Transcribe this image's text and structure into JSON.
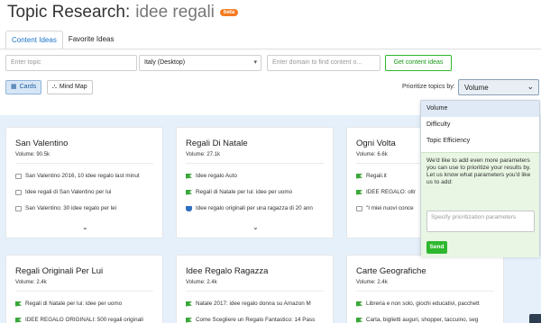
{
  "header": {
    "title_prefix": "Topic Research:",
    "keyword": "idee regali",
    "badge": "beta"
  },
  "tabs": [
    {
      "label": "Content Ideas",
      "active": true
    },
    {
      "label": "Favorite Ideas",
      "active": false
    }
  ],
  "search": {
    "topic_placeholder": "Enter topic",
    "region_value": "Italy (Desktop)",
    "domain_placeholder": "Enter domain to find content o...",
    "submit_label": "Get content ideas"
  },
  "view": {
    "cards_label": "Cards",
    "mindmap_label": "Mind Map"
  },
  "prioritize": {
    "label": "Prioritize topics by:",
    "selected": "Volume",
    "options": [
      "Volume",
      "Difficulty",
      "Topic Efficiency"
    ],
    "promo_text": "We'd like to add even more parameters you can use to prioritize your results by. Let us know what parameters you'd like us to add:",
    "input_placeholder": "Specify prioritization parameters",
    "send_label": "Send"
  },
  "cards": [
    {
      "title": "San Valentino",
      "volume": "Volume: 90.5k",
      "items": [
        {
          "icon": "doc",
          "text": "San Valentino 2016, 10 idee regalo last minut"
        },
        {
          "icon": "doc",
          "text": "Idee regali di San Valentino per lui"
        },
        {
          "icon": "doc",
          "text": "San Valentino: 30 idee regalo per lei"
        }
      ]
    },
    {
      "title": "Regali Di Natale",
      "volume": "Volume: 27.1k",
      "items": [
        {
          "icon": "flag",
          "text": "Idee regalo Auto"
        },
        {
          "icon": "flag",
          "text": "Regali di Natale per lui: idee per uomo"
        },
        {
          "icon": "shield",
          "text": "Idee regalo originali per una ragazza di 20 ann"
        }
      ]
    },
    {
      "title": "Ogni Volta",
      "volume": "Volume: 6.6k",
      "items": [
        {
          "icon": "flag",
          "text": "Regali.it"
        },
        {
          "icon": "flag",
          "text": "IDEE REGALO: oltr"
        },
        {
          "icon": "doc",
          "text": "\"I miei nuovi conce"
        }
      ]
    },
    {
      "title": "Regali Originali Per Lui",
      "volume": "Volume: 2.4k",
      "items": [
        {
          "icon": "flag",
          "text": "Regali di Natale per lui: idee per uomo"
        },
        {
          "icon": "flag",
          "text": "IDEE REGALO ORIGINALI: 500 regali originali"
        }
      ]
    },
    {
      "title": "Idee Regalo Ragazza",
      "volume": "Volume: 2.4k",
      "items": [
        {
          "icon": "flag",
          "text": "Natale 2017: idee regalo donna su Amazon M"
        },
        {
          "icon": "flag",
          "text": "Come Scegliere un Regalo Fantastico: 14 Pass"
        }
      ]
    },
    {
      "title": "Carte Geografiche",
      "volume": "Volume: 2.4k",
      "items": [
        {
          "icon": "flag",
          "text": "Libreria e non solo, giochi educativi, pacchett"
        },
        {
          "icon": "flag",
          "text": "Carta, biglietti auguri, shopper, taccuino, seg"
        }
      ]
    }
  ]
}
